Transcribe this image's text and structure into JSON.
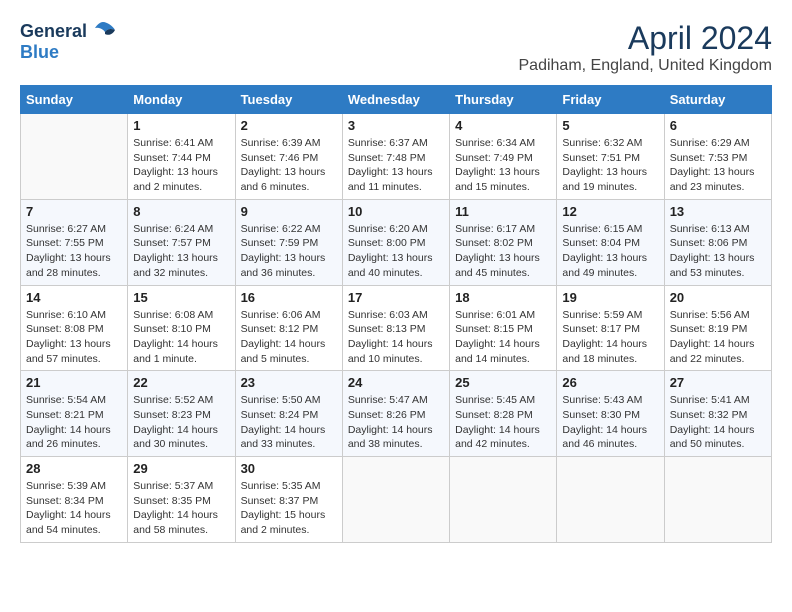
{
  "logo": {
    "general": "General",
    "blue": "Blue"
  },
  "title": {
    "month_year": "April 2024",
    "location": "Padiham, England, United Kingdom"
  },
  "days_header": [
    "Sunday",
    "Monday",
    "Tuesday",
    "Wednesday",
    "Thursday",
    "Friday",
    "Saturday"
  ],
  "weeks": [
    [
      {
        "num": "",
        "empty": true
      },
      {
        "num": "1",
        "sunrise": "Sunrise: 6:41 AM",
        "sunset": "Sunset: 7:44 PM",
        "daylight": "Daylight: 13 hours and 2 minutes."
      },
      {
        "num": "2",
        "sunrise": "Sunrise: 6:39 AM",
        "sunset": "Sunset: 7:46 PM",
        "daylight": "Daylight: 13 hours and 6 minutes."
      },
      {
        "num": "3",
        "sunrise": "Sunrise: 6:37 AM",
        "sunset": "Sunset: 7:48 PM",
        "daylight": "Daylight: 13 hours and 11 minutes."
      },
      {
        "num": "4",
        "sunrise": "Sunrise: 6:34 AM",
        "sunset": "Sunset: 7:49 PM",
        "daylight": "Daylight: 13 hours and 15 minutes."
      },
      {
        "num": "5",
        "sunrise": "Sunrise: 6:32 AM",
        "sunset": "Sunset: 7:51 PM",
        "daylight": "Daylight: 13 hours and 19 minutes."
      },
      {
        "num": "6",
        "sunrise": "Sunrise: 6:29 AM",
        "sunset": "Sunset: 7:53 PM",
        "daylight": "Daylight: 13 hours and 23 minutes."
      }
    ],
    [
      {
        "num": "7",
        "sunrise": "Sunrise: 6:27 AM",
        "sunset": "Sunset: 7:55 PM",
        "daylight": "Daylight: 13 hours and 28 minutes."
      },
      {
        "num": "8",
        "sunrise": "Sunrise: 6:24 AM",
        "sunset": "Sunset: 7:57 PM",
        "daylight": "Daylight: 13 hours and 32 minutes."
      },
      {
        "num": "9",
        "sunrise": "Sunrise: 6:22 AM",
        "sunset": "Sunset: 7:59 PM",
        "daylight": "Daylight: 13 hours and 36 minutes."
      },
      {
        "num": "10",
        "sunrise": "Sunrise: 6:20 AM",
        "sunset": "Sunset: 8:00 PM",
        "daylight": "Daylight: 13 hours and 40 minutes."
      },
      {
        "num": "11",
        "sunrise": "Sunrise: 6:17 AM",
        "sunset": "Sunset: 8:02 PM",
        "daylight": "Daylight: 13 hours and 45 minutes."
      },
      {
        "num": "12",
        "sunrise": "Sunrise: 6:15 AM",
        "sunset": "Sunset: 8:04 PM",
        "daylight": "Daylight: 13 hours and 49 minutes."
      },
      {
        "num": "13",
        "sunrise": "Sunrise: 6:13 AM",
        "sunset": "Sunset: 8:06 PM",
        "daylight": "Daylight: 13 hours and 53 minutes."
      }
    ],
    [
      {
        "num": "14",
        "sunrise": "Sunrise: 6:10 AM",
        "sunset": "Sunset: 8:08 PM",
        "daylight": "Daylight: 13 hours and 57 minutes."
      },
      {
        "num": "15",
        "sunrise": "Sunrise: 6:08 AM",
        "sunset": "Sunset: 8:10 PM",
        "daylight": "Daylight: 14 hours and 1 minute."
      },
      {
        "num": "16",
        "sunrise": "Sunrise: 6:06 AM",
        "sunset": "Sunset: 8:12 PM",
        "daylight": "Daylight: 14 hours and 5 minutes."
      },
      {
        "num": "17",
        "sunrise": "Sunrise: 6:03 AM",
        "sunset": "Sunset: 8:13 PM",
        "daylight": "Daylight: 14 hours and 10 minutes."
      },
      {
        "num": "18",
        "sunrise": "Sunrise: 6:01 AM",
        "sunset": "Sunset: 8:15 PM",
        "daylight": "Daylight: 14 hours and 14 minutes."
      },
      {
        "num": "19",
        "sunrise": "Sunrise: 5:59 AM",
        "sunset": "Sunset: 8:17 PM",
        "daylight": "Daylight: 14 hours and 18 minutes."
      },
      {
        "num": "20",
        "sunrise": "Sunrise: 5:56 AM",
        "sunset": "Sunset: 8:19 PM",
        "daylight": "Daylight: 14 hours and 22 minutes."
      }
    ],
    [
      {
        "num": "21",
        "sunrise": "Sunrise: 5:54 AM",
        "sunset": "Sunset: 8:21 PM",
        "daylight": "Daylight: 14 hours and 26 minutes."
      },
      {
        "num": "22",
        "sunrise": "Sunrise: 5:52 AM",
        "sunset": "Sunset: 8:23 PM",
        "daylight": "Daylight: 14 hours and 30 minutes."
      },
      {
        "num": "23",
        "sunrise": "Sunrise: 5:50 AM",
        "sunset": "Sunset: 8:24 PM",
        "daylight": "Daylight: 14 hours and 33 minutes."
      },
      {
        "num": "24",
        "sunrise": "Sunrise: 5:47 AM",
        "sunset": "Sunset: 8:26 PM",
        "daylight": "Daylight: 14 hours and 38 minutes."
      },
      {
        "num": "25",
        "sunrise": "Sunrise: 5:45 AM",
        "sunset": "Sunset: 8:28 PM",
        "daylight": "Daylight: 14 hours and 42 minutes."
      },
      {
        "num": "26",
        "sunrise": "Sunrise: 5:43 AM",
        "sunset": "Sunset: 8:30 PM",
        "daylight": "Daylight: 14 hours and 46 minutes."
      },
      {
        "num": "27",
        "sunrise": "Sunrise: 5:41 AM",
        "sunset": "Sunset: 8:32 PM",
        "daylight": "Daylight: 14 hours and 50 minutes."
      }
    ],
    [
      {
        "num": "28",
        "sunrise": "Sunrise: 5:39 AM",
        "sunset": "Sunset: 8:34 PM",
        "daylight": "Daylight: 14 hours and 54 minutes."
      },
      {
        "num": "29",
        "sunrise": "Sunrise: 5:37 AM",
        "sunset": "Sunset: 8:35 PM",
        "daylight": "Daylight: 14 hours and 58 minutes."
      },
      {
        "num": "30",
        "sunrise": "Sunrise: 5:35 AM",
        "sunset": "Sunset: 8:37 PM",
        "daylight": "Daylight: 15 hours and 2 minutes."
      },
      {
        "num": "",
        "empty": true
      },
      {
        "num": "",
        "empty": true
      },
      {
        "num": "",
        "empty": true
      },
      {
        "num": "",
        "empty": true
      }
    ]
  ]
}
